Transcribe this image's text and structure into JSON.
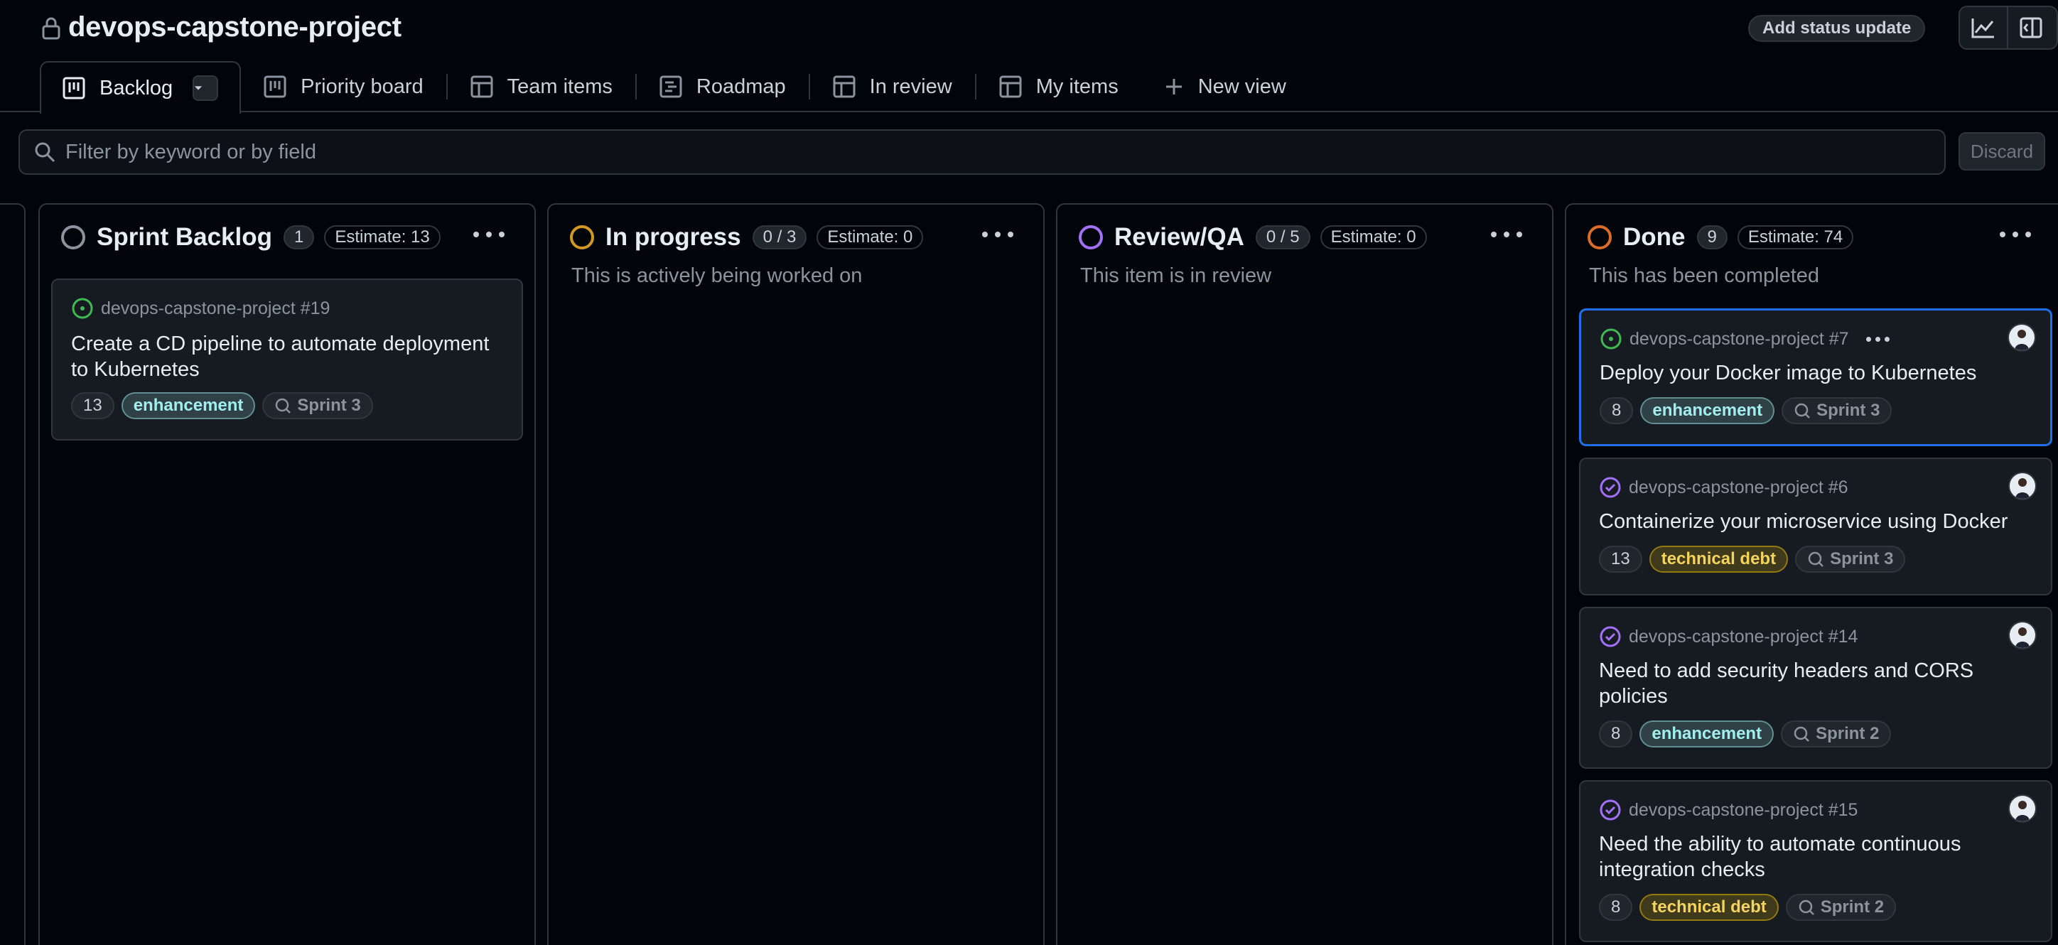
{
  "project": {
    "title": "devops-capstone-project",
    "status_button": "Add status update"
  },
  "tabs": [
    {
      "label": "Backlog",
      "icon": "board-icon"
    },
    {
      "label": "Priority board",
      "icon": "board-icon"
    },
    {
      "label": "Team items",
      "icon": "table-icon"
    },
    {
      "label": "Roadmap",
      "icon": "roadmap-icon"
    },
    {
      "label": "In review",
      "icon": "table-icon"
    },
    {
      "label": "My items",
      "icon": "table-icon"
    },
    {
      "label": "New view",
      "icon": "plus-icon"
    }
  ],
  "filter": {
    "placeholder": "Filter by keyword or by field",
    "discard_label": "Discard"
  },
  "colors": {
    "blue": "#1f6feb",
    "green": "#3fb950",
    "purple": "#a371f7",
    "orange": "#db6d28",
    "yellow": "#d29922",
    "gray": "#8b949e"
  },
  "columns": [
    {
      "title": "Sprint Backlog",
      "count": "1",
      "estimate": "Estimate: 13",
      "description": "",
      "cards": [
        {
          "ref": "devops-capstone-project #19",
          "title": "Create a CD pipeline to automate deployment to Kubernetes",
          "estimate": "13",
          "label": "enhancement",
          "sprint": "Sprint 3",
          "status": "open"
        }
      ]
    },
    {
      "title": "In progress",
      "count": "0 / 3",
      "estimate": "Estimate: 0",
      "description": "This is actively being worked on",
      "cards": []
    },
    {
      "title": "Review/QA",
      "count": "0 / 5",
      "estimate": "Estimate: 0",
      "description": "This item is in review",
      "cards": []
    },
    {
      "title": "Done",
      "count": "9",
      "estimate": "Estimate: 74",
      "description": "This has been completed",
      "cards": [
        {
          "ref": "devops-capstone-project #7",
          "title": "Deploy your Docker image to Kubernetes",
          "estimate": "8",
          "label": "enhancement",
          "sprint": "Sprint 3",
          "status": "open"
        },
        {
          "ref": "devops-capstone-project #6",
          "title": "Containerize your microservice using Docker",
          "estimate": "13",
          "label": "technical debt",
          "sprint": "Sprint 3",
          "status": "closed"
        },
        {
          "ref": "devops-capstone-project #14",
          "title": "Need to add security headers and CORS policies",
          "estimate": "8",
          "label": "enhancement",
          "sprint": "Sprint 2",
          "status": "closed"
        },
        {
          "ref": "devops-capstone-project #15",
          "title": "Need the ability to automate continuous integration checks",
          "estimate": "8",
          "label": "technical debt",
          "sprint": "Sprint 2",
          "status": "closed"
        }
      ]
    }
  ]
}
